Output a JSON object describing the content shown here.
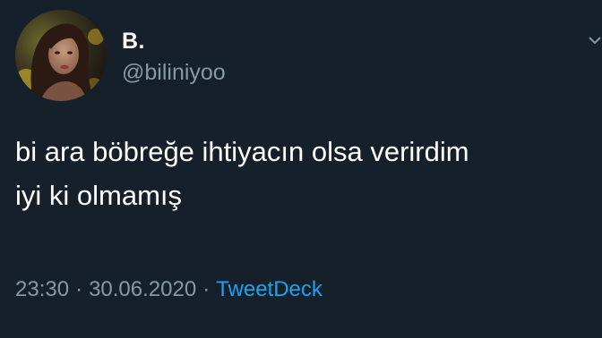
{
  "tweet": {
    "author": {
      "display_name": "B.",
      "handle": "@biliniyoo",
      "avatar": "profile-photo"
    },
    "text_lines": [
      "bi ara böbreğe ihtiyacın olsa verirdim",
      "iyi ki olmamış"
    ],
    "time": "23:30",
    "separator": "·",
    "date": "30.06.2020",
    "source": "TweetDeck"
  },
  "colors": {
    "background": "#15202b",
    "text_primary": "#ffffff",
    "text_secondary": "#8899a6",
    "link": "#1da1f2"
  },
  "icons": {
    "menu": "chevron-down-icon"
  }
}
